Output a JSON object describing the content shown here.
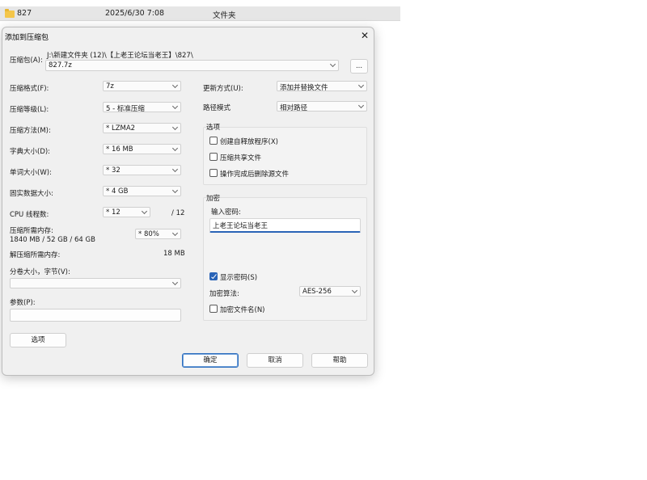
{
  "explorer": {
    "name": "827",
    "date": "2025/6/30 7:08",
    "type": "文件夹"
  },
  "dialog": {
    "title": "添加到压缩包",
    "archive_label": "压缩包(A):",
    "archive_path": "J:\\新建文件夹 (12)\\【上老王论坛当老王】\\827\\",
    "archive_name": "827.7z",
    "browse_label": "...",
    "format_label": "压缩格式(F):",
    "format_value": "7z",
    "level_label": "压缩等级(L):",
    "level_value": "5 - 标准压缩",
    "method_label": "压缩方法(M):",
    "method_value": "* LZMA2",
    "dict_label": "字典大小(D):",
    "dict_value": "* 16 MB",
    "word_label": "单词大小(W):",
    "word_value": "* 32",
    "solid_label": "固实数据大小:",
    "solid_value": "* 4 GB",
    "threads_label": "CPU 线程数:",
    "threads_value": "* 12",
    "threads_max": "/ 12",
    "mem_label": "压缩所需内存:",
    "mem_detail": "1840 MB / 52 GB / 64 GB",
    "mem_value": "* 80%",
    "decomp_label": "解压缩所需内存:",
    "decomp_value": "18 MB",
    "split_label": "分卷大小，字节(V):",
    "split_value": "",
    "params_label": "参数(P):",
    "params_value": "",
    "update_label": "更新方式(U):",
    "update_value": "添加并替换文件",
    "pathmode_label": "路径模式",
    "pathmode_value": "相对路径",
    "options_group": "选项",
    "opt_sfx": "创建自释放程序(X)",
    "opt_shared": "压缩共享文件",
    "opt_delete": "操作完成后删除源文件",
    "encrypt_group": "加密",
    "pwd_label": "输入密码:",
    "pwd_value": "上老王论坛当老王",
    "show_pwd": "显示密码(S)",
    "enc_method_label": "加密算法:",
    "enc_method_value": "AES-256",
    "enc_names": "加密文件名(N)",
    "options_button": "选项",
    "ok": "确定",
    "cancel": "取消",
    "help": "帮助",
    "close_glyph": "✕"
  }
}
